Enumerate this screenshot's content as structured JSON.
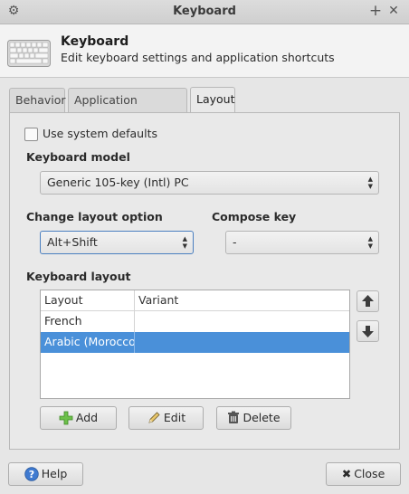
{
  "window": {
    "title": "Keyboard"
  },
  "header": {
    "title": "Keyboard",
    "subtitle": "Edit keyboard settings and application shortcuts"
  },
  "tabs": [
    {
      "label": "Behavior",
      "active": false
    },
    {
      "label": "Application Shortcuts",
      "active": false
    },
    {
      "label": "Layout",
      "active": true
    }
  ],
  "layout": {
    "use_system_defaults": {
      "label": "Use system defaults",
      "checked": false
    },
    "keyboard_model": {
      "label": "Keyboard model",
      "value": "Generic 105-key (Intl) PC"
    },
    "change_layout_option": {
      "label": "Change layout option",
      "value": "Alt+Shift"
    },
    "compose_key": {
      "label": "Compose key",
      "value": "-"
    },
    "keyboard_layout": {
      "label": "Keyboard layout",
      "columns": [
        "Layout",
        "Variant"
      ],
      "rows": [
        {
          "layout": "French",
          "variant": "",
          "selected": false
        },
        {
          "layout": "Arabic (Morocco)",
          "variant": "",
          "selected": true
        }
      ]
    },
    "buttons": {
      "add": "Add",
      "edit": "Edit",
      "delete": "Delete"
    }
  },
  "footer": {
    "help": "Help",
    "close": "Close"
  },
  "colors": {
    "selection": "#4a90d9",
    "focus_border": "#4a7fc0"
  }
}
